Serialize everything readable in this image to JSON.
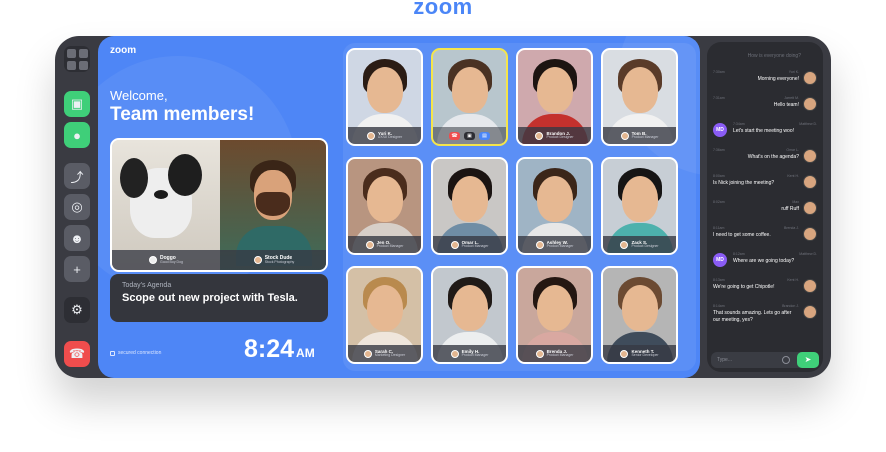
{
  "brand": "zoom",
  "rail": {
    "items": [
      {
        "name": "grid-icon",
        "glyph": ""
      },
      {
        "name": "video-icon",
        "glyph": "▣"
      },
      {
        "name": "mic-icon",
        "glyph": "●"
      },
      {
        "name": "share-screen-icon",
        "glyph": "⤴"
      },
      {
        "name": "camera-icon",
        "glyph": "◎"
      },
      {
        "name": "participants-icon",
        "glyph": "☻"
      },
      {
        "name": "add-user-icon",
        "glyph": "+"
      },
      {
        "name": "settings-icon",
        "glyph": "⚙"
      },
      {
        "name": "end-call-icon",
        "glyph": "☎"
      }
    ]
  },
  "main": {
    "logo": "zoom",
    "welcome": "Welcome,",
    "team": "Team members!",
    "feature": [
      {
        "name": "Doggo",
        "role": "Good Boy Dog"
      },
      {
        "name": "Stock Dude",
        "role": "Stock Photography"
      }
    ],
    "agenda_label": "Today's Agenda",
    "agenda_title": "Scope out new project with Tesla.",
    "secure": "secured connection",
    "time": "8:24",
    "ampm": "AM"
  },
  "tiles": [
    {
      "name": "Yuri K.",
      "role": "UX/UI Designer",
      "bg": "#cfd7e4",
      "hair": "#2b1c14",
      "body": "#f1f1f1"
    },
    {
      "name": "",
      "role": "",
      "bg": "#b8c6cd",
      "hair": "#4a3223",
      "body": "#e5e8ec",
      "active": true
    },
    {
      "name": "Brandon J.",
      "role": "Product Designer",
      "bg": "#cfa9ad",
      "hair": "#1c1411",
      "body": "#c4312d"
    },
    {
      "name": "Tom B.",
      "role": "Product Manager",
      "bg": "#d9dde2",
      "hair": "#5a3b29",
      "body": "#f1f1f1"
    },
    {
      "name": "Jen O.",
      "role": "Product Manager",
      "bg": "#b89580",
      "hair": "#4a2c1c",
      "body": "#d7cfc8"
    },
    {
      "name": "Omar L.",
      "role": "Product Manager",
      "bg": "#c9c7c5",
      "hair": "#1b1412",
      "body": "#6f8da5"
    },
    {
      "name": "Ashley W.",
      "role": "Product Manager",
      "bg": "#9fb4c5",
      "hair": "#3b2619",
      "body": "#e7e7e7"
    },
    {
      "name": "Zack S.",
      "role": "Product Designer",
      "bg": "#c7ced5",
      "hair": "#161515",
      "body": "#4db1ad"
    },
    {
      "name": "Sarah C.",
      "role": "Marketing Designer",
      "bg": "#d4c0a6",
      "hair": "#b98a4e",
      "body": "#efe6dc"
    },
    {
      "name": "Emily H.",
      "role": "Product Manager",
      "bg": "#c2c8ce",
      "hair": "#201a17",
      "body": "#eceeef"
    },
    {
      "name": "Brenda J.",
      "role": "Product Manager",
      "bg": "#c9a79c",
      "hair": "#241712",
      "body": "#d9a8a1"
    },
    {
      "name": "Kenneth T.",
      "role": "Senior Developer",
      "bg": "#b5b5b5",
      "hair": "#6b4a32",
      "body": "#3f4c5b"
    }
  ],
  "chat": {
    "top": "How is everyone doing?",
    "messages": [
      {
        "text": "Morning everyone!",
        "who": "Yuri K.",
        "time": "7:30am",
        "md": false,
        "right": true
      },
      {
        "text": "Hello team!",
        "who": "Jarrett M.",
        "time": "7:31am",
        "md": false,
        "right": true
      },
      {
        "text": "Let's start the meeting woo!",
        "who": "Matthew D.",
        "time": "7:34am",
        "md": true,
        "right": false
      },
      {
        "text": "What's on the agenda?",
        "who": "Omar L.",
        "time": "7:36am",
        "md": false,
        "right": true
      },
      {
        "text": "Is Nick joining the meeting?",
        "who": "Kent H.",
        "time": "8:00am",
        "md": false,
        "right": false
      },
      {
        "text": "ruff Ruff",
        "who": "Max",
        "time": "8:02am",
        "md": false,
        "right": true
      },
      {
        "text": "I need to get some coffee.",
        "who": "Brenda J.",
        "time": "8:11am",
        "md": false,
        "right": false
      },
      {
        "text": "Where are we going today?",
        "who": "Matthew D.",
        "time": "8:12am",
        "md": true,
        "right": false
      },
      {
        "text": "We're going to get Chipotle!",
        "who": "Kent H.",
        "time": "8:13am",
        "md": false,
        "right": false
      },
      {
        "text": "That sounds amazing. Lets go after our meeting, yes?",
        "who": "Brandon J.",
        "time": "8:14am",
        "md": false,
        "right": false
      }
    ],
    "md_initials": "MD",
    "input_placeholder": "Type...",
    "send": "➤"
  }
}
